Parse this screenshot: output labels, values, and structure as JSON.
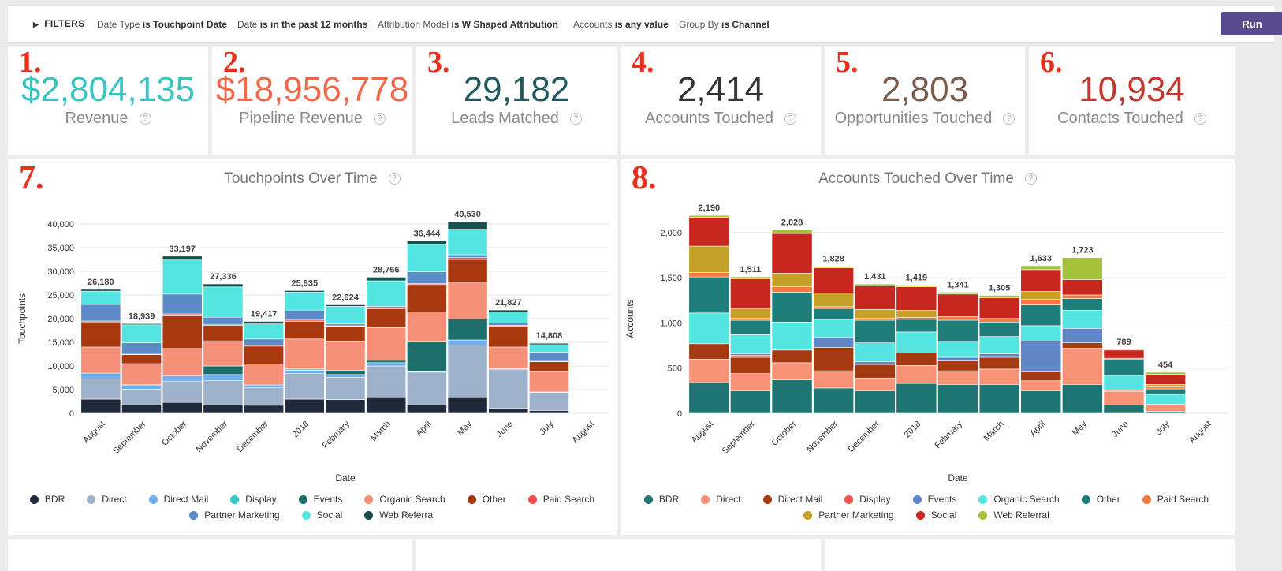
{
  "filters": {
    "toggle_label": "FILTERS",
    "items": [
      {
        "name": "Date Type",
        "op": "is Touchpoint Date"
      },
      {
        "name": "Date",
        "op": "is in the past 12 months"
      },
      {
        "name": "Attribution Model",
        "op": "is W Shaped Attribution"
      },
      {
        "name": "Accounts",
        "op": "is any value"
      },
      {
        "name": "Group By",
        "op": "is Channel"
      }
    ],
    "run_label": "Run",
    "run_color": "#5a4a8f"
  },
  "tiles": [
    {
      "marker": "1.",
      "value": "$2,804,135",
      "label": "Revenue",
      "color": "#3cc4c0"
    },
    {
      "marker": "2.",
      "value": "$18,956,778",
      "label": "Pipeline Revenue",
      "color": "#f0684a"
    },
    {
      "marker": "3.",
      "value": "29,182",
      "label": "Leads Matched",
      "color": "#215a5e"
    },
    {
      "marker": "4.",
      "value": "2,414",
      "label": "Accounts Touched",
      "color": "#333333"
    },
    {
      "marker": "5.",
      "value": "2,803",
      "label": "Opportunities Touched",
      "color": "#7a5c4c"
    },
    {
      "marker": "6.",
      "value": "10,934",
      "label": "Contacts Touched",
      "color": "#c03730"
    }
  ],
  "help_icon_glyph": "?",
  "chart_data": [
    {
      "marker": "7.",
      "type": "bar",
      "stacked": true,
      "title": "Touchpoints Over Time",
      "xlabel": "Date",
      "ylabel": "Touchpoints",
      "ylim": [
        0,
        42000
      ],
      "yticks": [
        0,
        5000,
        10000,
        15000,
        20000,
        25000,
        30000,
        35000,
        40000
      ],
      "ytick_labels": [
        "0",
        "5,000",
        "10,000",
        "15,000",
        "20,000",
        "25,000",
        "30,000",
        "35,000",
        "40,000"
      ],
      "categories": [
        "August",
        "September",
        "October",
        "November",
        "December",
        "2018",
        "February",
        "March",
        "April",
        "May",
        "June",
        "July",
        "August"
      ],
      "totals": [
        26180,
        18939,
        33197,
        27336,
        19417,
        25935,
        22924,
        28766,
        36444,
        40530,
        21827,
        14808,
        14808
      ],
      "total_labels": [
        "26,180",
        "18,939",
        "33,197",
        "27,336",
        "19,417",
        "25,935",
        "22,924",
        "28,766",
        "36,444",
        "40,530",
        "21,827",
        "14,808"
      ],
      "legend_rows": [
        [
          "BDR",
          "Direct",
          "Direct Mail",
          "Display",
          "Events",
          "Organic Search",
          "Other",
          "Paid Search"
        ],
        [
          "Partner Marketing",
          "Social",
          "Web Referral"
        ]
      ],
      "series": [
        {
          "name": "BDR",
          "color": "#202a3a",
          "values": [
            3000,
            1800,
            2300,
            1800,
            1700,
            3000,
            2900,
            3300,
            1800,
            3300,
            1100,
            600
          ]
        },
        {
          "name": "Direct",
          "color": "#9fb2cc",
          "values": [
            4300,
            3300,
            4500,
            5100,
            3700,
            5400,
            4700,
            6700,
            6900,
            11100,
            8200,
            3800
          ]
        },
        {
          "name": "Direct Mail",
          "color": "#6eaef0",
          "values": [
            1200,
            700,
            1100,
            1300,
            600,
            700,
            500,
            700,
            100,
            1100,
            100,
            100
          ]
        },
        {
          "name": "Display",
          "color": "#36c8c2",
          "values": [
            0,
            100,
            0,
            0,
            0,
            100,
            100,
            0,
            0,
            0,
            0,
            0
          ]
        },
        {
          "name": "Events",
          "color": "#1c6e6a",
          "values": [
            0,
            200,
            0,
            1800,
            0,
            200,
            900,
            500,
            6300,
            4400,
            0,
            0
          ]
        },
        {
          "name": "Organic Search",
          "color": "#f69079",
          "values": [
            5500,
            4400,
            5800,
            5300,
            4400,
            6300,
            6000,
            6900,
            6300,
            7800,
            4600,
            4300
          ]
        },
        {
          "name": "Other",
          "color": "#a8390f",
          "values": [
            5300,
            1900,
            6900,
            3300,
            3800,
            3700,
            3300,
            4000,
            5800,
            4800,
            4400,
            2100
          ]
        },
        {
          "name": "Paid Search",
          "color": "#f2504c",
          "values": [
            200,
            100,
            400,
            200,
            200,
            300,
            100,
            200,
            200,
            400,
            200,
            100
          ]
        },
        {
          "name": "Partner Marketing",
          "color": "#5b8cc8",
          "values": [
            3500,
            2400,
            4200,
            1500,
            1300,
            2100,
            400,
            300,
            2500,
            600,
            500,
            1900
          ]
        },
        {
          "name": "Social",
          "color": "#55e5e0",
          "values": [
            2800,
            3800,
            7400,
            6400,
            3200,
            3800,
            3700,
            5400,
            5800,
            5400,
            2300,
            1600
          ]
        },
        {
          "name": "Web Referral",
          "color": "#16514e",
          "values": [
            380,
            239,
            597,
            636,
            517,
            335,
            324,
            766,
            744,
            1630,
            427,
            308
          ]
        }
      ]
    },
    {
      "marker": "8.",
      "type": "bar",
      "stacked": true,
      "title": "Accounts Touched Over Time",
      "xlabel": "Date",
      "ylabel": "Accounts",
      "ylim": [
        0,
        2200
      ],
      "yticks": [
        0,
        500,
        1000,
        1500,
        2000
      ],
      "ytick_labels": [
        "0",
        "500",
        "1,000",
        "1,500",
        "2,000"
      ],
      "categories": [
        "August",
        "September",
        "October",
        "November",
        "December",
        "2018",
        "February",
        "March",
        "April",
        "May",
        "June",
        "July",
        "August"
      ],
      "total_labels": [
        "2,190",
        "1,511",
        "2,028",
        "1,828",
        "1,431",
        "1,419",
        "1,341",
        "1,305",
        "1,633",
        "1,723",
        "789",
        "454"
      ],
      "legend_rows": [
        [
          "BDR",
          "Direct",
          "Direct Mail",
          "Display",
          "Events",
          "Organic Search",
          "Other",
          "Paid Search"
        ],
        [
          "Partner Marketing",
          "Social",
          "Web Referral"
        ]
      ],
      "series": [
        {
          "name": "BDR",
          "color": "#1f7571",
          "values": [
            340,
            250,
            370,
            280,
            250,
            330,
            320,
            320,
            250,
            320,
            90,
            20
          ]
        },
        {
          "name": "Direct",
          "color": "#f79277",
          "values": [
            260,
            190,
            190,
            190,
            140,
            200,
            150,
            170,
            110,
            400,
            150,
            70
          ]
        },
        {
          "name": "Direct Mail",
          "color": "#a5390f",
          "values": [
            170,
            180,
            140,
            260,
            150,
            140,
            110,
            130,
            100,
            60,
            10,
            10
          ]
        },
        {
          "name": "Display",
          "color": "#f0544e",
          "values": [
            0,
            20,
            0,
            0,
            0,
            0,
            0,
            0,
            0,
            0,
            10,
            0
          ]
        },
        {
          "name": "Events",
          "color": "#5f87c7",
          "values": [
            0,
            20,
            0,
            110,
            30,
            0,
            40,
            40,
            340,
            160,
            0,
            0
          ]
        },
        {
          "name": "Organic Search",
          "color": "#55e5e0",
          "values": [
            340,
            210,
            310,
            200,
            210,
            230,
            180,
            190,
            170,
            200,
            160,
            110
          ]
        },
        {
          "name": "Other",
          "color": "#1f7d7a",
          "values": [
            400,
            160,
            330,
            120,
            250,
            140,
            230,
            160,
            230,
            130,
            180,
            60
          ]
        },
        {
          "name": "Paid Search",
          "color": "#f47a41",
          "values": [
            50,
            20,
            60,
            20,
            20,
            20,
            40,
            40,
            60,
            40,
            10,
            20
          ]
        },
        {
          "name": "Partner Marketing",
          "color": "#c5a12a",
          "values": [
            290,
            110,
            150,
            150,
            100,
            80,
            0,
            0,
            90,
            0,
            0,
            30
          ]
        },
        {
          "name": "Social",
          "color": "#c8271f",
          "values": [
            320,
            330,
            440,
            280,
            260,
            260,
            250,
            230,
            240,
            170,
            90,
            110
          ]
        },
        {
          "name": "Web Referral",
          "color": "#a4c23a",
          "values": [
            20,
            21,
            38,
            18,
            21,
            19,
            21,
            25,
            43,
            243,
            9,
            24
          ]
        }
      ]
    }
  ]
}
